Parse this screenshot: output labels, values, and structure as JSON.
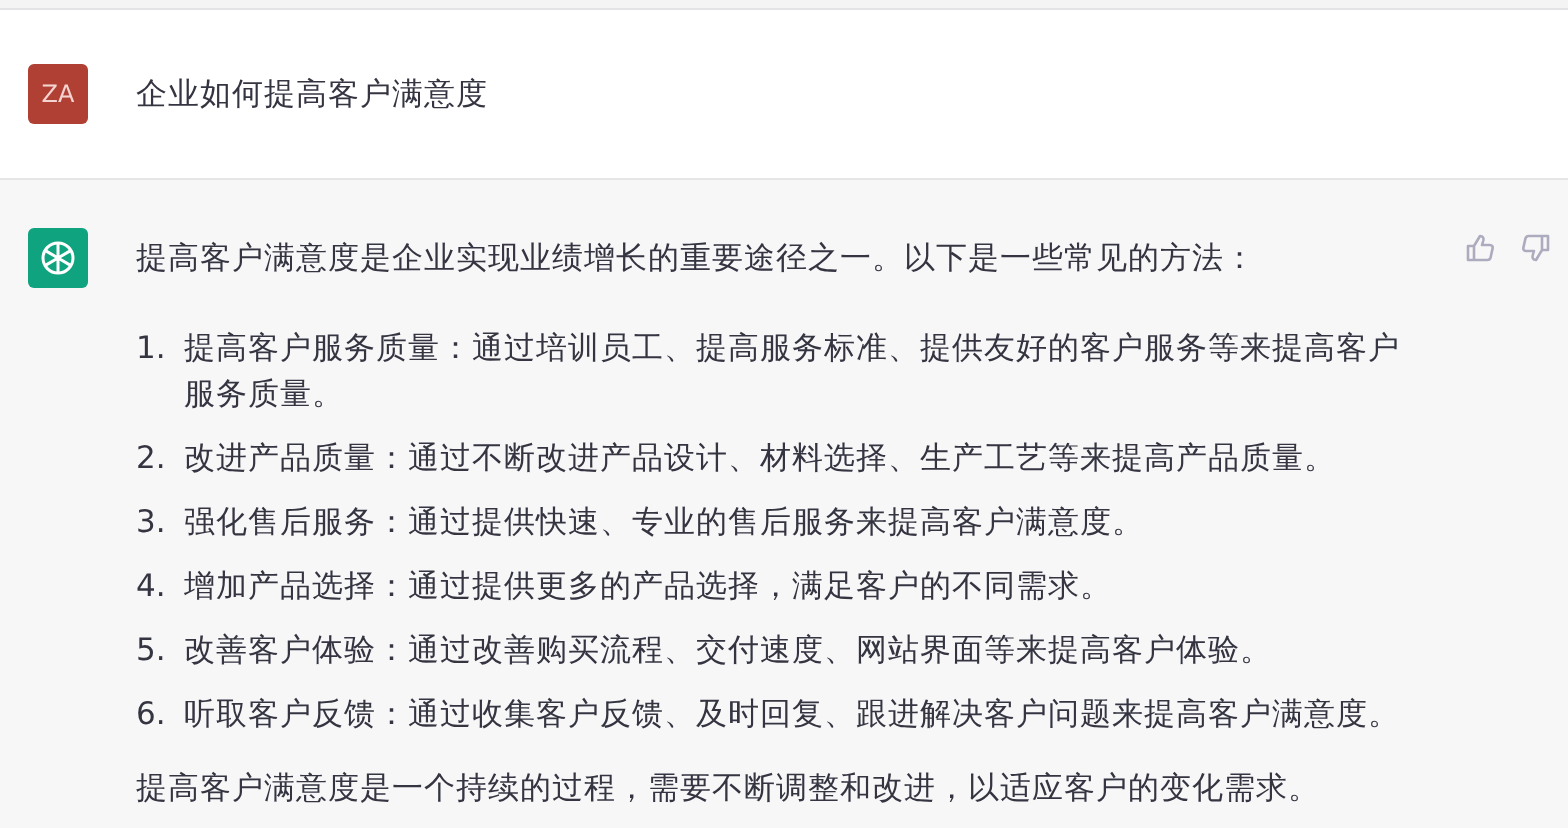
{
  "messages": [
    {
      "kind": "user",
      "avatar": "ZA",
      "text": "企业如何提高客户满意度"
    },
    {
      "kind": "assistant",
      "intro": "提高客户满意度是企业实现业绩增长的重要途径之一。以下是一些常见的方法：",
      "items": [
        {
          "number": "1.",
          "text": "提高客户服务质量：通过培训员工、提高服务标准、提供友好的客户服务等来提高客户服务质量。"
        },
        {
          "number": "2.",
          "text": "改进产品质量：通过不断改进产品设计、材料选择、生产工艺等来提高产品质量。"
        },
        {
          "number": "3.",
          "text": "强化售后服务：通过提供快速、专业的售后服务来提高客户满意度。"
        },
        {
          "number": "4.",
          "text": "增加产品选择：通过提供更多的产品选择，满足客户的不同需求。"
        },
        {
          "number": "5.",
          "text": "改善客户体验：通过改善购买流程、交付速度、网站界面等来提高客户体验。"
        },
        {
          "number": "6.",
          "text": "听取客户反馈：通过收集客户反馈、及时回复、跟进解决客户问题来提高客户满意度。"
        }
      ],
      "closing": "提高客户满意度是一个持续的过程，需要不断调整和改进，以适应客户的变化需求。"
    }
  ]
}
